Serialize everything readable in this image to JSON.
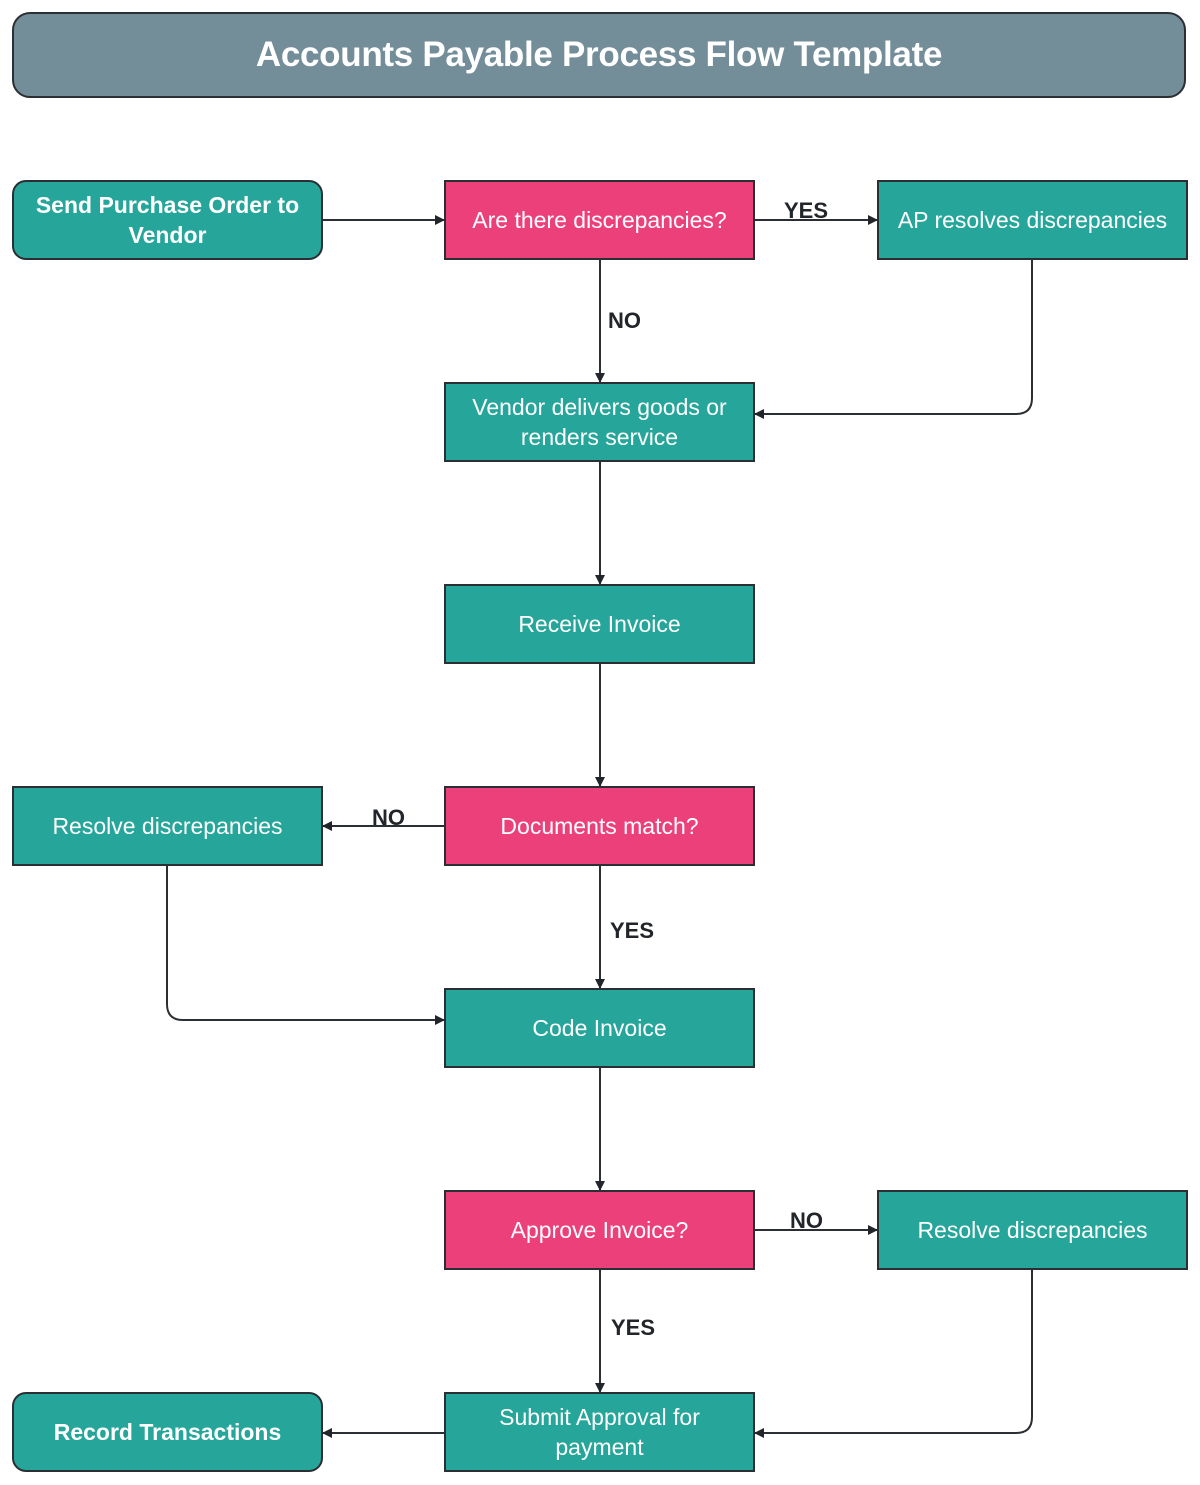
{
  "title": "Accounts Payable Process Flow Template",
  "colors": {
    "title_fill": "#738d99",
    "process_fill": "#26a69a",
    "decision_fill": "#ec407a",
    "stroke": "#2b2f33",
    "text": "#ffffff",
    "label_text": "#222529"
  },
  "nodes": {
    "send_po": {
      "text": "Send Purchase Order to Vendor",
      "type": "terminal"
    },
    "discrepancies_q": {
      "text": "Are there discrepancies?",
      "type": "decision"
    },
    "ap_resolves": {
      "text": "AP resolves discrepancies",
      "type": "process"
    },
    "vendor_delivers": {
      "text": "Vendor delivers goods or renders service",
      "type": "process"
    },
    "receive_invoice": {
      "text": "Receive Invoice",
      "type": "process"
    },
    "documents_match": {
      "text": "Documents match?",
      "type": "decision"
    },
    "resolve_left": {
      "text": "Resolve discrepancies",
      "type": "process"
    },
    "code_invoice": {
      "text": "Code Invoice",
      "type": "process"
    },
    "approve_invoice": {
      "text": "Approve Invoice?",
      "type": "decision"
    },
    "resolve_right": {
      "text": "Resolve discrepancies",
      "type": "process"
    },
    "submit_approval": {
      "text": "Submit Approval for payment",
      "type": "process"
    },
    "record_transactions": {
      "text": "Record Transactions",
      "type": "terminal"
    }
  },
  "edges": [
    {
      "from": "send_po",
      "to": "discrepancies_q",
      "label": ""
    },
    {
      "from": "discrepancies_q",
      "to": "ap_resolves",
      "label": "YES"
    },
    {
      "from": "discrepancies_q",
      "to": "vendor_delivers",
      "label": "NO"
    },
    {
      "from": "ap_resolves",
      "to": "vendor_delivers",
      "label": ""
    },
    {
      "from": "vendor_delivers",
      "to": "receive_invoice",
      "label": ""
    },
    {
      "from": "receive_invoice",
      "to": "documents_match",
      "label": ""
    },
    {
      "from": "documents_match",
      "to": "resolve_left",
      "label": "NO"
    },
    {
      "from": "documents_match",
      "to": "code_invoice",
      "label": "YES"
    },
    {
      "from": "resolve_left",
      "to": "code_invoice",
      "label": ""
    },
    {
      "from": "code_invoice",
      "to": "approve_invoice",
      "label": ""
    },
    {
      "from": "approve_invoice",
      "to": "resolve_right",
      "label": "NO"
    },
    {
      "from": "approve_invoice",
      "to": "submit_approval",
      "label": "YES"
    },
    {
      "from": "resolve_right",
      "to": "submit_approval",
      "label": ""
    },
    {
      "from": "submit_approval",
      "to": "record_transactions",
      "label": ""
    }
  ]
}
